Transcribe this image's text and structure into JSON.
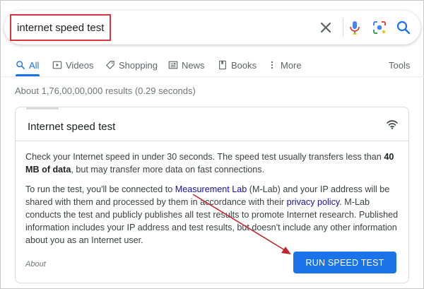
{
  "search": {
    "query": "internet speed test"
  },
  "icons": {
    "clear": "close-icon",
    "mic": "microphone-icon",
    "lens": "camera-lens-icon",
    "search": "search-icon",
    "wifi": "wifi-icon"
  },
  "tabs": [
    {
      "label": "All",
      "icon": "search-icon",
      "active": true
    },
    {
      "label": "Videos",
      "icon": "play-icon",
      "active": false
    },
    {
      "label": "Shopping",
      "icon": "tag-icon",
      "active": false
    },
    {
      "label": "News",
      "icon": "newspaper-icon",
      "active": false
    },
    {
      "label": "Books",
      "icon": "book-icon",
      "active": false
    },
    {
      "label": "More",
      "icon": "more-vert-icon",
      "active": false
    }
  ],
  "tools_label": "Tools",
  "result_stats": "About 1,76,00,00,000 results (0.29 seconds)",
  "card": {
    "title": "Internet speed test",
    "paragraph1": {
      "text_a": "Check your Internet speed in under 30 seconds. The speed test usually transfers less than ",
      "bold": "40 MB of data",
      "text_b": ", but may transfer more data on fast connections."
    },
    "paragraph2": {
      "text_a": "To run the test, you'll be connected to ",
      "link1": "Measurement Lab",
      "text_b": " (M-Lab) and your IP address will be shared with them and processed by them in accordance with their ",
      "link2": "privacy policy",
      "text_c": ". M-Lab conducts the test and publicly publishes all test results to promote Internet research. Published information includes your IP address and test results, but doesn't include any other information about you as an Internet user."
    },
    "about_label": "About",
    "button_label": "RUN SPEED TEST"
  },
  "colors": {
    "accent": "#1a73e8",
    "highlight_box": "#d5363b",
    "annotation_arrow": "#c0282e",
    "link": "#1a0dab"
  }
}
